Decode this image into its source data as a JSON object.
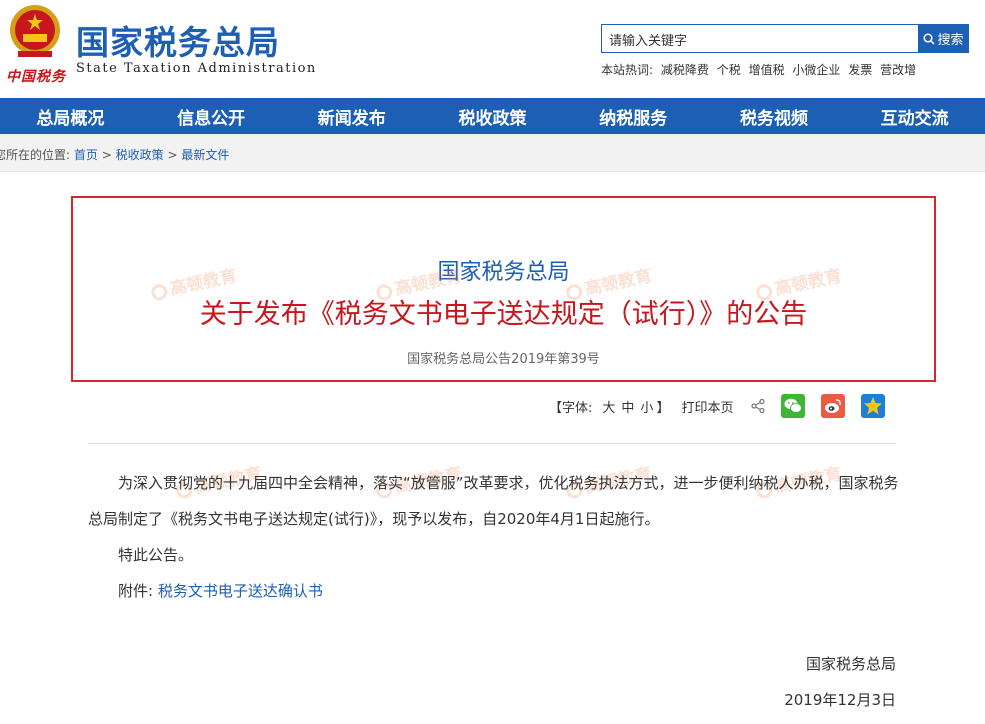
{
  "header": {
    "site_name": "国家税务总局",
    "site_name_en": "State Taxation Administration",
    "emblem_caption": "中国税务"
  },
  "search": {
    "value": "请输入关键字",
    "button_label": "搜索",
    "hot_label": "本站热词:",
    "hot_terms": [
      "减税降费",
      "个税",
      "增值税",
      "小微企业",
      "发票",
      "营改增"
    ]
  },
  "nav": {
    "items": [
      "总局概况",
      "信息公开",
      "新闻发布",
      "税收政策",
      "纳税服务",
      "税务视频",
      "互动交流"
    ]
  },
  "breadcrumb": {
    "prefix": "您所在的位置:",
    "items": [
      "首页",
      "税收政策",
      "最新文件"
    ],
    "separator": ">"
  },
  "document": {
    "issuer": "国家税务总局",
    "title": "关于发布《税务文书电子送达规定（试行）》的公告",
    "number": "国家税务总局公告2019年第39号",
    "para1": "为深入贯彻党的十九届四中全会精神，落实“放管服”改革要求，优化税务执法方式，进一步便利纳税人办税，国家税务总局制定了《税务文书电子送达规定(试行)》，现予以发布，自2020年4月1日起施行。",
    "para2": "特此公告。",
    "attachment_label": "附件:",
    "attachment_link": "税务文书电子送达确认书",
    "signer": "国家税务总局",
    "date": "2019年12月3日"
  },
  "toolbar": {
    "font_label_open": "【字体:",
    "size_large": "大",
    "size_medium": "中",
    "size_small": "小",
    "font_label_close": "】",
    "print_label": "打印本页"
  },
  "watermark": {
    "text": "高顿教育"
  },
  "colors": {
    "brand_blue": "#1d5fb4",
    "title_red": "#c8161d",
    "border_red": "#d8252c"
  }
}
